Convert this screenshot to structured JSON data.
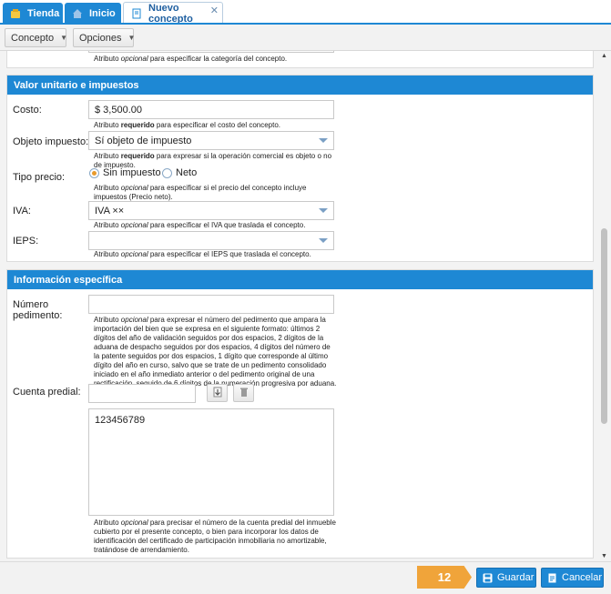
{
  "tabs": [
    {
      "label": "Tienda",
      "icon": "store-icon"
    },
    {
      "label": "Inicio",
      "icon": "home-icon"
    },
    {
      "label": "Nuevo concepto",
      "icon": "document-icon",
      "active": true,
      "close": "✕"
    }
  ],
  "toolbar": {
    "concepto": "Concepto",
    "opciones": "Opciones"
  },
  "top_hint": {
    "pre": "Atributo ",
    "em": "opcional",
    "post": " para especificar la categoría del concepto."
  },
  "sections": {
    "valor": {
      "title": "Valor unitario e impuestos",
      "costo": {
        "label": "Costo:",
        "value": "$ 3,500.00",
        "hint_pre": "Atributo ",
        "hint_strong": "requerido",
        "hint_post": " para especificar el costo del concepto."
      },
      "objeto": {
        "label": "Objeto impuesto:",
        "value": "Sí objeto de impuesto",
        "hint_pre": "Atributo ",
        "hint_strong": "requerido",
        "hint_post": " para expresar si la operación comercial es objeto o no de impuesto."
      },
      "tipo": {
        "label": "Tipo precio:",
        "opt1": "Sin impuesto",
        "opt2": "Neto",
        "hint_pre": "Atributo ",
        "hint_em": "opcional",
        "hint_post": " para especificar si el precio del concepto incluye impuestos (Precio neto)."
      },
      "iva": {
        "label": "IVA:",
        "value": "IVA ××",
        "hint_pre": "Atributo ",
        "hint_em": "opcional",
        "hint_post": " para especificar el IVA que traslada el concepto."
      },
      "ieps": {
        "label": "IEPS:",
        "value": "",
        "hint_pre": "Atributo ",
        "hint_em": "opcional",
        "hint_post": " para especificar el IEPS que traslada el concepto."
      }
    },
    "info": {
      "title": "Información específica",
      "pedimento": {
        "label1": "Número",
        "label2": "pedimento:",
        "value": "",
        "hint_pre": "Atributo ",
        "hint_em": "opcional",
        "hint_post": " para expresar el número del pedimento que ampara la importación del bien que se expresa en el siguiente formato: últimos 2 dígitos del año de validación seguidos por dos espacios, 2 dígitos de la aduana de despacho seguidos por dos espacios, 4 dígitos del número de la patente seguidos por dos espacios, 1 dígito que corresponde al último dígito del año en curso, salvo que se trate de un pedimento consolidado iniciado en el año inmediato anterior o del pedimento original de una rectificación, seguido de 6 dígitos de la numeración progresiva por aduana."
      },
      "predial": {
        "label": "Cuenta predial:",
        "input": "",
        "list_value": "123456789",
        "hint_pre": "Atributo ",
        "hint_em": "opcional",
        "hint_post": " para precisar el número de la cuenta predial del inmueble cubierto por el presente concepto, o bien para incorporar los datos de identificación del certificado de participación inmobiliaria no amortizable, tratándose de arrendamiento."
      }
    }
  },
  "footer": {
    "badge": "12",
    "save": "Guardar",
    "cancel": "Cancelar"
  },
  "colors": {
    "accent": "#1e88d4",
    "badge": "#f0a43a",
    "radio_on": "#e89a2c"
  }
}
